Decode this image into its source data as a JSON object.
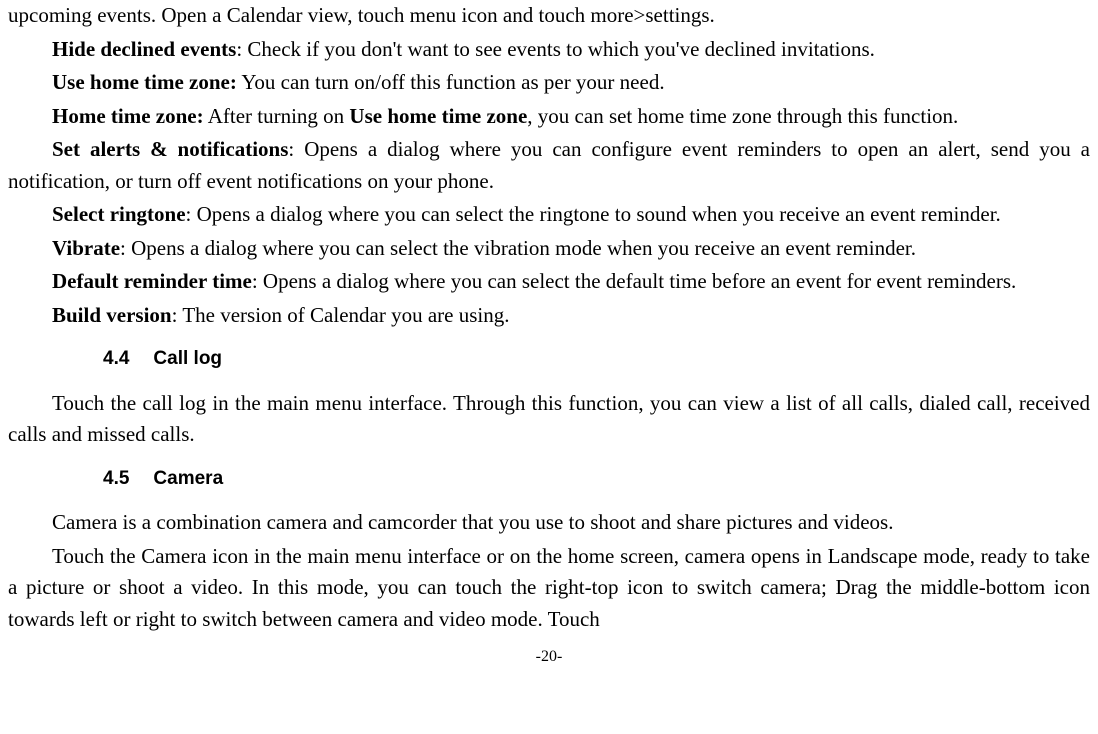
{
  "paragraphs": {
    "p0": "upcoming events. Open a Calendar view, touch menu icon and touch more>settings.",
    "p1_bold": "Hide declined events",
    "p1_rest": ": Check if you don't want to see events to which you've declined invitations.",
    "p2_bold": "Use home time zone:",
    "p2_rest": " You can turn on/off this function as per your need.",
    "p3_bold1": "Home time zone:",
    "p3_mid": " After turning on ",
    "p3_bold2": "Use home time zone",
    "p3_rest": ", you can set home time zone through this function.",
    "p4_bold": "Set alerts & notifications",
    "p4_rest": ": Opens a dialog where you can configure event reminders to open an alert, send you a notification, or turn off event notifications on your phone.",
    "p5_bold": "Select ringtone",
    "p5_rest": ": Opens a dialog where you can select the ringtone to sound when you receive an event reminder.",
    "p6_bold": "Vibrate",
    "p6_rest": ": Opens a dialog where you can select the vibration mode when you receive an event reminder.",
    "p7_bold": "Default reminder time",
    "p7_rest": ": Opens a dialog where you can select the default time before an event for event reminders.",
    "p8_bold": "Build version",
    "p8_rest": ": The version of Calendar you are using."
  },
  "sections": {
    "s1_num": "4.4",
    "s1_title": "Call log",
    "s1_body": "Touch the call log in the main menu interface. Through this function, you can view a list of all calls, dialed call, received calls and missed calls.",
    "s2_num": "4.5",
    "s2_title": "Camera",
    "s2_body1": "Camera is a combination camera and camcorder that you use to shoot and share pictures and videos.",
    "s2_body2": "Touch the Camera icon in the main menu interface or on the home screen, camera opens in Landscape mode, ready to take a picture or shoot a video. In this mode, you can touch the right-top icon to switch camera; Drag the middle-bottom icon towards left or right to switch between camera and video mode. Touch"
  },
  "page_number": "-20-"
}
